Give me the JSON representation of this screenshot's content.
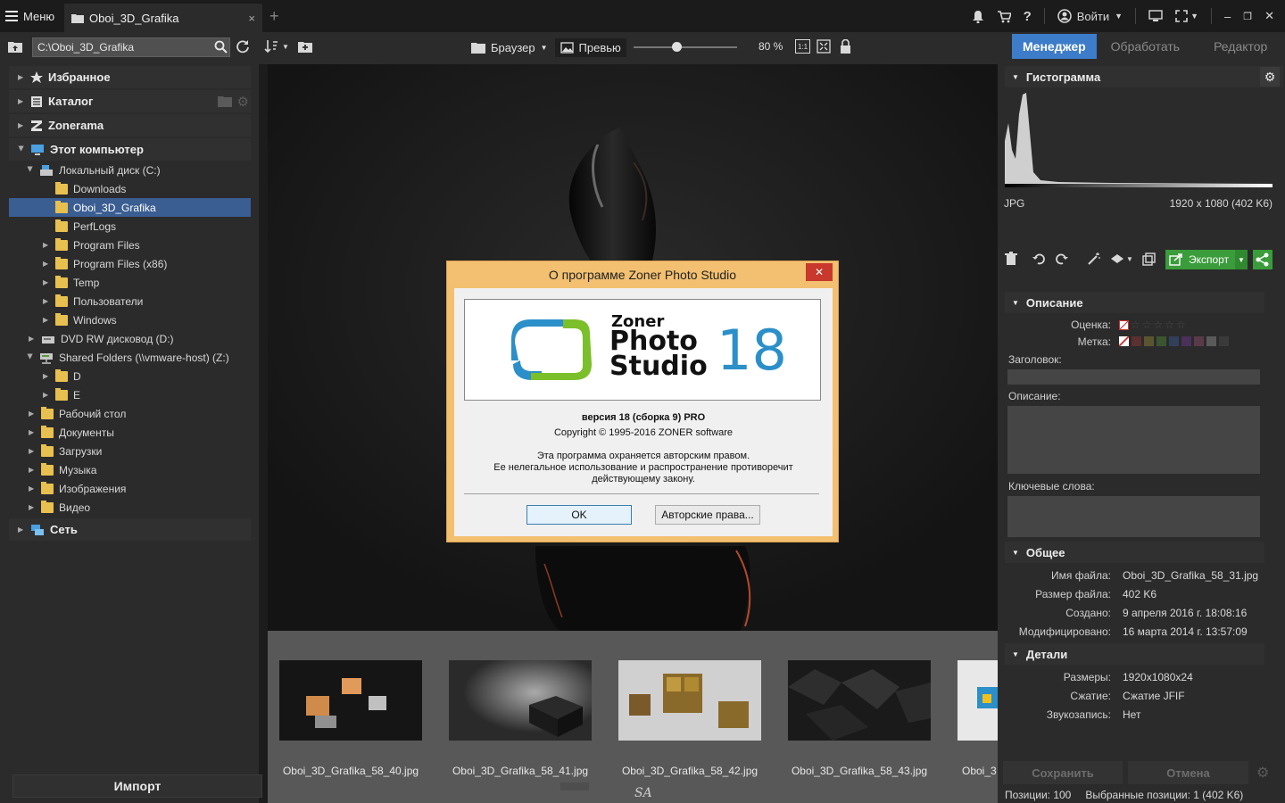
{
  "topbar": {
    "menu_label": "Меню",
    "tab_title": "Oboi_3D_Grafika",
    "tab_close": "×",
    "tab_add": "+",
    "login_label": "Войти"
  },
  "toolbar": {
    "path": "C:\\Oboi_3D_Grafika",
    "browser_label": "Браузер",
    "preview_label": "Превью",
    "zoom_level": "80 %",
    "zoom_1to1": "1:1",
    "slider_fraction": 0.42
  },
  "mode_tabs": [
    {
      "label": "Менеджер",
      "active": true
    },
    {
      "label": "Обработать",
      "active": false
    },
    {
      "label": "Редактор",
      "active": false
    }
  ],
  "left_panel": {
    "sections": {
      "favorites": "Избранное",
      "catalog": "Каталог",
      "zonerama": "Zonerama",
      "this_pc": "Этот компьютер",
      "network": "Сеть"
    },
    "tree": [
      {
        "label": "Локальный диск (C:)",
        "type": "drive"
      },
      {
        "label": "Downloads",
        "type": "folder"
      },
      {
        "label": "Oboi_3D_Grafika",
        "type": "folder",
        "selected": true
      },
      {
        "label": "PerfLogs",
        "type": "folder"
      },
      {
        "label": "Program Files",
        "type": "folder"
      },
      {
        "label": "Program Files (x86)",
        "type": "folder"
      },
      {
        "label": "Temp",
        "type": "folder"
      },
      {
        "label": "Пользователи",
        "type": "folder"
      },
      {
        "label": "Windows",
        "type": "folder"
      },
      {
        "label": "DVD RW дисковод (D:)",
        "type": "drive"
      },
      {
        "label": "Shared Folders (\\\\vmware-host) (Z:)",
        "type": "drive"
      },
      {
        "label": "D",
        "type": "folder"
      },
      {
        "label": "E",
        "type": "folder"
      },
      {
        "label": "Рабочий стол",
        "type": "folder"
      },
      {
        "label": "Документы",
        "type": "folder"
      },
      {
        "label": "Загрузки",
        "type": "folder"
      },
      {
        "label": "Музыка",
        "type": "folder"
      },
      {
        "label": "Изображения",
        "type": "folder"
      },
      {
        "label": "Видео",
        "type": "folder"
      }
    ],
    "import_label": "Импорт"
  },
  "dialog": {
    "title": "О программе Zoner Photo Studio",
    "close": "✕",
    "logo_word1": "Zoner",
    "logo_word2": "Photo",
    "logo_word3": "Studio",
    "logo_number": "18",
    "version": "версия 18 (сборка 9) PRO",
    "copyright": "Copyright © 1995-2016 ZONER software",
    "legal_line1": "Эта программа охраняется авторским правом.",
    "legal_line2": "Ее нелегальное использование и распространение противоречит",
    "legal_line3": "действующему закону.",
    "ok_label": "OK",
    "rights_label": "Авторские права..."
  },
  "filmstrip": {
    "items": [
      {
        "label": "Oboi_3D_Grafika_58_40.jpg"
      },
      {
        "label": "Oboi_3D_Grafika_58_41.jpg"
      },
      {
        "label": "Oboi_3D_Grafika_58_42.jpg"
      },
      {
        "label": "Oboi_3D_Grafika_58_43.jpg"
      },
      {
        "label": "Oboi_3"
      }
    ],
    "watermark": "SA"
  },
  "right_panel": {
    "histogram_title": "Гистограмма",
    "format": "JPG",
    "dimensions_size": "1920 x 1080 (402 K6)",
    "export_label": "Экспорт",
    "description_section": "Описание",
    "rating_label": "Оценка:",
    "mark_label": "Метка:",
    "title_label": "Заголовок:",
    "description_label": "Описание:",
    "keywords_label": "Ключевые слова:",
    "general_section": "Общее",
    "general": [
      {
        "label": "Имя файла:",
        "value": "Oboi_3D_Grafika_58_31.jpg"
      },
      {
        "label": "Размер файла:",
        "value": "402 K6"
      },
      {
        "label": "Создано:",
        "value": "9 апреля 2016 г. 18:08:16"
      },
      {
        "label": "Модифицировано:",
        "value": "16 марта 2014 г. 13:57:09"
      }
    ],
    "details_section": "Детали",
    "details": [
      {
        "label": "Размеры:",
        "value": "1920x1080x24"
      },
      {
        "label": "Сжатие:",
        "value": "Сжатие JFIF"
      },
      {
        "label": "Звукозапись:",
        "value": "Нет"
      }
    ],
    "save_label": "Сохранить",
    "cancel_label": "Отмена",
    "status_positions": "Позиции: 100",
    "status_selected": "Выбранные позиции: 1 (402 K6)"
  },
  "colors": {
    "accent": "#3d7cc9",
    "selection": "#3a5d92",
    "export_green": "#3a9c3a",
    "dialog_frame": "#f2c070",
    "logo_blue": "#2b8fc9",
    "logo_green": "#7bbf2a"
  }
}
